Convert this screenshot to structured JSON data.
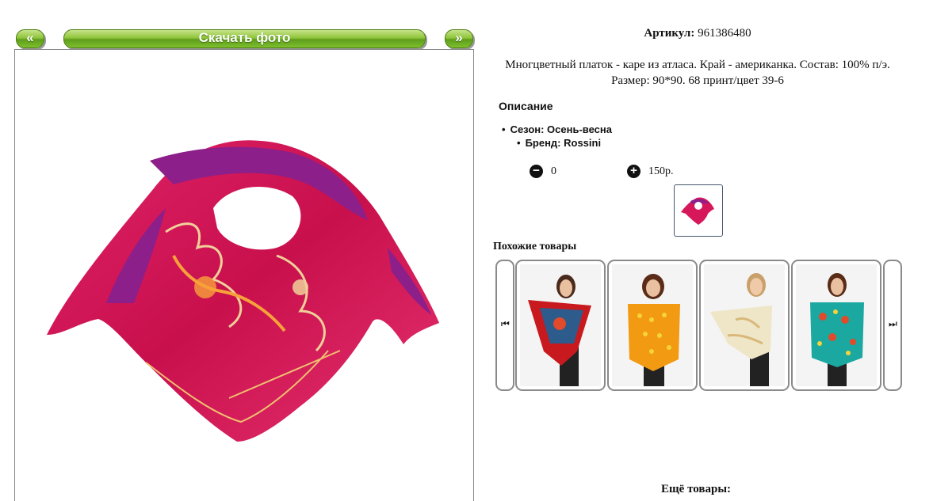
{
  "nav": {
    "prev_label": "«",
    "next_label": "»",
    "download_label": "Скачать фото"
  },
  "product": {
    "sku_label": "Артикул:",
    "sku_value": "961386480",
    "description_line1": "Многцветный платок - каре из атласа. Край - американка. Состав: 100% п/э.",
    "description_line2": "Размер: 90*90. 68 принт/цвет 39-6",
    "description_heading": "Описание",
    "attributes": [
      "Сезон: Осень-весна",
      "Бренд: Rossini"
    ],
    "qty_value": "0",
    "price": "150р."
  },
  "similar": {
    "heading": "Похожие товары",
    "prev_icon": "skip-back-icon",
    "next_icon": "skip-forward-icon",
    "items": [
      {
        "color": "#c8191e",
        "pattern": "#2c5b8c"
      },
      {
        "color": "#f29a12",
        "pattern": "#f5d33a"
      },
      {
        "color": "#efe6c8",
        "pattern": "#d9b87a"
      },
      {
        "color": "#1ba8a0",
        "pattern": "#e14a2a"
      }
    ]
  },
  "more": {
    "heading": "Ещё товары:"
  },
  "colors": {
    "accent_green": "#7fbf2e",
    "scarf_main": "#d6185a",
    "scarf_purple": "#8c1f8a"
  }
}
